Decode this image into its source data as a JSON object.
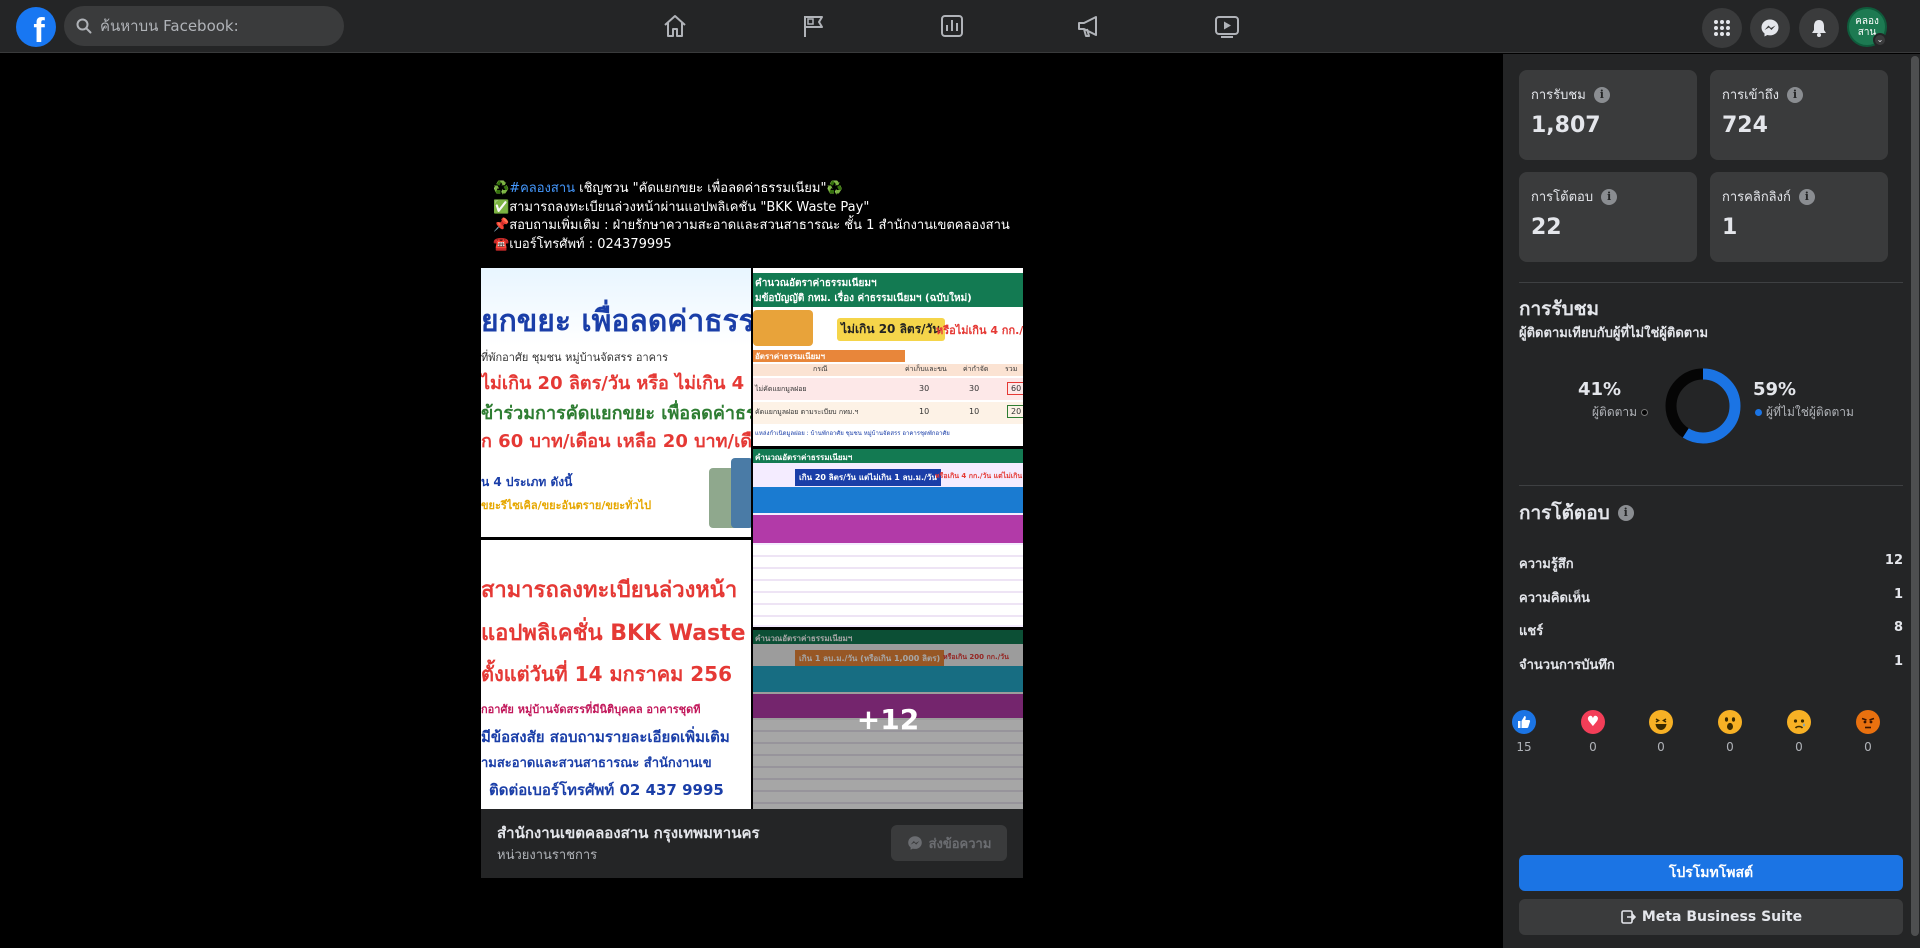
{
  "topbar": {
    "logo": "f",
    "search_placeholder": "ค้นหาบน Facebook:",
    "nav_icons": [
      "home-icon",
      "flag-icon",
      "chart-icon",
      "megaphone-icon",
      "video-icon"
    ],
    "right_icons": [
      "menu-grid-icon",
      "messenger-icon",
      "notifications-bell-icon"
    ],
    "avatar_text": "คลอง สาน"
  },
  "post": {
    "line1_hash": "#คลองสาน",
    "line1_rest": " เชิญชวน \"คัดแยกขยะ เพื่อลดค่าธรรมเนียม\"",
    "line2": "สามารถลงทะเบียนล่วงหน้าผ่านแอปพลิเคชัน \"BKK Waste Pay\"",
    "line3": "สอบถามเพิ่มเติม : ฝ่ายรักษาความสะอาดและสวนสาธารณะ ชั้น 1 สำนักงานเขตคลองสาน",
    "line4": "เบอร์โทรศัพท์ : 024379995",
    "emoji_recycle": "♻️",
    "emoji_check": "✅",
    "emoji_pin": "📌",
    "emoji_phone": "☎️",
    "images": {
      "img1_line1": "ยกขยะ เพื่อลดค่าธรรม",
      "img1_line2": "ที่พักอาศัย ชุมชน หมู่บ้านจัดสรร อาคาร",
      "img1_line3": "ไม่เกิน 20 ลิตร/วัน หรือ ไม่เกิน 4",
      "img1_line4": "ข้าร่วมการคัดแยกขยะ เพื่อลดค่าธรร",
      "img1_line5": "ก 60 บาท/เดือน เหลือ 20 บาท/เดื",
      "img1_line6": "น 4 ประเภท ดังนี้",
      "img1_line7": "ขยะรีไซเคิล/ขยะอันตราย/ขยะทั่วไป",
      "img2_line1": "สามารถลงทะเบียนล่วงหน้า",
      "img2_line2": "แอปพลิเคชั่น BKK Waste P",
      "img2_line3": "ตั้งแต่วันที่ 14 มกราคม 256",
      "img2_line4": "กอาศัย หมู่บ้านจัดสรรที่มีนิติบุคคล อาคารชุดที",
      "img2_line5": "มีข้อสงสัย สอบถามรายละเอียดเพิ่มเติม",
      "img2_line6": "ามสะอาดและสวนสาธารณะ สำนักงานเข",
      "img2_line7": "ติดต่อเบอร์โทรศัพท์ 02 437 9995",
      "img3_title": "คำนวณอัตราค่าธรรมเนียมฯ",
      "img3_sub": "มข้อบัญญัติ กทม. เรื่อง ค่าธรรมเนียมฯ (ฉบับใหม่)",
      "img3_limit": "ไม่เกิน 20 ลิตร/วัน",
      "img3_or": "หรือไม่เกิน 4 กก./",
      "img3_table_title": "อัตราค่าธรรมเนียมฯ",
      "img3_col1": "กรณี",
      "img3_col2": "ค่าเก็บและขน",
      "img3_col3": "ค่ากำจัด",
      "img3_col4": "รวม",
      "img3_row1": "ไม่คัดแยกมูลฝอย",
      "img3_row1_v1": "30",
      "img3_row1_v2": "30",
      "img3_row1_v3": "60",
      "img3_row2": "คัดแยกมูลฝอย ตามระเบียบ กทม.ฯ",
      "img3_row2_v1": "10",
      "img3_row2_v2": "10",
      "img3_row2_v3": "20",
      "img3_foot": "แหล่งกำเนิดมูลฝอย : บ้านพักอาศัย ชุมชน หมู่บ้านจัดสรร อาคารชุดพักอาศัย",
      "img4_title": "คำนวณอัตราค่าธรรมเนียมฯ",
      "img4_limit": "เกิน 20 ลิตร/วัน แต่ไม่เกิน 1 ลบ.ม./วัน",
      "img4_or": "หรือเกิน 4 กก./วัน แต่ไม่เกิน 200",
      "img5_title": "คำนวณอัตราค่าธรรมเนียมฯ",
      "img5_limit": "เกิน 1 ลบ.ม./วัน (หรือเกิน 1,000 ลิตร)",
      "img5_or": "หรือเกิน 200 กก./วัน",
      "more_count": "+12"
    }
  },
  "page_card": {
    "name": "สำนักงานเขตคลองสาน กรุงเทพมหานคร",
    "category": "หน่วยงานราชการ",
    "message_button": "ส่งข้อความ"
  },
  "insights": {
    "stats": [
      {
        "label": "การรับชม",
        "value": "1,807"
      },
      {
        "label": "การเข้าถึง",
        "value": "724"
      },
      {
        "label": "การโต้ตอบ",
        "value": "22"
      },
      {
        "label": "การคลิกลิงก์",
        "value": "1"
      }
    ],
    "views_title": "การรับชม",
    "views_subtitle": "ผู้ติดตามเทียบกับผู้ที่ไม่ใช่ผู้ติดตาม",
    "followers_pct": "41%",
    "followers_label": "ผู้ติดตาม",
    "non_followers_pct": "59%",
    "non_followers_label": "ผู้ที่ไม่ใช่ผู้ติดตาม",
    "engagement_title": "การโต้ตอบ",
    "engagement_rows": [
      {
        "label": "ความรู้สึก",
        "value": "12"
      },
      {
        "label": "ความคิดเห็น",
        "value": "1"
      },
      {
        "label": "แชร์",
        "value": "8"
      },
      {
        "label": "จำนวนการบันทึก",
        "value": "1"
      }
    ],
    "reactions": [
      {
        "icon": "like-icon",
        "color": "#1b74e4",
        "glyph": "👍",
        "count": "15"
      },
      {
        "icon": "love-icon",
        "color": "#f33e58",
        "glyph": "♥",
        "count": "0"
      },
      {
        "icon": "haha-icon",
        "color": "#f7b125",
        "glyph": "😆",
        "count": "0"
      },
      {
        "icon": "wow-icon",
        "color": "#f7b125",
        "glyph": "😮",
        "count": "0"
      },
      {
        "icon": "sad-icon",
        "color": "#f7b125",
        "glyph": "😢",
        "count": "0"
      },
      {
        "icon": "angry-icon",
        "color": "#e9710f",
        "glyph": "😠",
        "count": "0"
      }
    ],
    "promote_button": "โปรโมทโพสต์",
    "business_suite_button": "Meta Business Suite"
  },
  "chart_data": {
    "type": "pie",
    "categories": [
      "ผู้ติดตาม",
      "ผู้ที่ไม่ใช่ผู้ติดตาม"
    ],
    "values": [
      41,
      59
    ],
    "colors": [
      "#050505",
      "#1b74e4"
    ]
  },
  "colors": {
    "accent": "#1b74e4",
    "panel_bg": "#242526",
    "card_bg": "#3a3b3c"
  }
}
